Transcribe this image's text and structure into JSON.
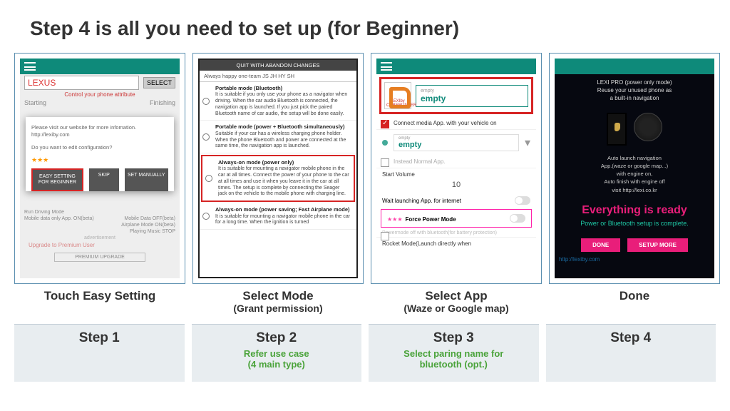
{
  "title": "Step 4 is all you need to set up (for Beginner)",
  "captions": {
    "c1": "Touch Easy Setting",
    "c2": "Select Mode",
    "c2b": "(Grant permission)",
    "c3": "Select App",
    "c3b": "(Waze or Google map)",
    "c4": "Done"
  },
  "steps": {
    "s1": "Step 1",
    "s2": "Step 2",
    "s2sub": "Refer use case\n(4 main type)",
    "s3": "Step 3",
    "s3sub": "Select paring name for\nbluetooth (opt.)",
    "s4": "Step 4"
  },
  "screen1": {
    "input": "LEXUS",
    "select": "SELECT",
    "controlLine": "Control your phone attribute",
    "starting": "Starting",
    "finishing": "Finishing",
    "dialog1": "Please visit our website for more infomation. http://lexiby.com",
    "dialog2": "Do you want to edit configuration?",
    "stars": "★★★",
    "easy": "EASY SETTING FOR BEGINNER",
    "skip": "SKIP",
    "manual": "SET MANUALLY",
    "runDriving": "Run Driving Mode",
    "mobileData": "Mobile data only App. ON(beta)",
    "mobileDataOff": "Mobile Data OFF(beta)",
    "airplane": "Airplane Mode ON(beta)",
    "playing": "Playing Music STOP",
    "advert": "advertisement",
    "upgrade": "Upgrade to Premium User",
    "premiumBtn": "PREMIUM UPGRADE"
  },
  "screen2": {
    "header": "QUIT WITH ABANDON CHANGES",
    "team": "Always happy one-team  JS JH HY SH",
    "opt1t": "Portable mode (Bluetooth)",
    "opt1": "It is suitable if you only use your phone as a navigator when driving. When the car audio Bluetooth is connected, the navigation app is launched. If you just pick the paired Bluetooth name of car audio, the setup will be done easily.",
    "opt2t": "Portable mode (power + Bluetooth simultaneously)",
    "opt2": "Suitable if your car has a wireless charging phone holder. When the phone Bluetooth and power are connected at the same time, the navigation app is launched.",
    "opt3t": "Always-on mode (power only)",
    "opt3": "It is suitable for mounting a navigator mobile phone in the car at all times. Connect the power of your phone to the car at all times and use it when you leave it in the car at all times. The setup is complete by connecting the Seager jack on the vehicle to the mobile phone with charging line.",
    "opt4t": "Always-on mode (power saving; Fast Airplane mode)",
    "opt4": "It is suitable for mounting a navigator mobile phone in the car for a long time. When the ignition is turned"
  },
  "screen3": {
    "appIconLabel": "LEXIby CUBERUNNER",
    "emptyLabel": "empty",
    "emptyVal": "empty",
    "connect": "Connect media App. with your vehicle on",
    "btLabel": "empty",
    "btVal": "empty",
    "normal": "Instead Normal App.",
    "startVol": "Start Volume",
    "vol": "10",
    "wait": "Wait launching App. for internet",
    "forceStars": "★★★",
    "force": "Force Power Mode",
    "pmOff": "Powermode off with bluetooth(for battery protection)",
    "rocket": "Rocket Mode(Launch directly when"
  },
  "screen4": {
    "hdr1": "LEXI PRO (power only mode)",
    "hdr2": "Reuse your unused phone as",
    "hdr3": "a built-in navigation",
    "info1": "Auto launch navigation",
    "info2": "App.(waze or google map...)",
    "info3": "with engine on,",
    "info4": "Auto finish with engine off",
    "info5": "visit http://lexi.co.kr",
    "ready": "Everything is ready",
    "sub": "Power or Bluetooth setup is complete.",
    "done": "DONE",
    "more": "SETUP MORE",
    "url": "http://lexiby.com"
  }
}
